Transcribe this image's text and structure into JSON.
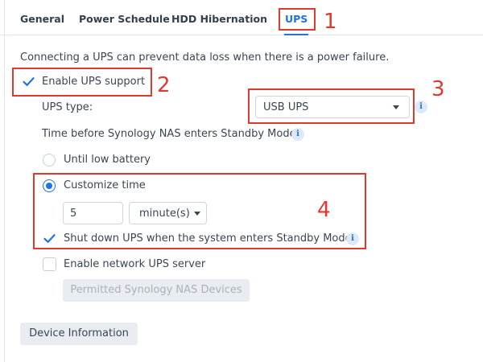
{
  "tabs": [
    {
      "label": "General",
      "active": false
    },
    {
      "label": "Power Schedule",
      "active": false
    },
    {
      "label": "HDD Hibernation",
      "active": false
    },
    {
      "label": "UPS",
      "active": true
    }
  ],
  "description": "Connecting a UPS can prevent data loss when there is a power failure.",
  "enable_ups": {
    "label": "Enable UPS support",
    "checked": true
  },
  "ups_type": {
    "label": "UPS type:",
    "value": "USB UPS",
    "info_icon": "i"
  },
  "standby": {
    "label": "Time before Synology NAS enters Standby Mode",
    "info_icon": "i"
  },
  "until_low_battery": {
    "label": "Until low battery",
    "checked": false
  },
  "customize_time": {
    "label": "Customize time",
    "checked": true
  },
  "time_value": "5",
  "time_unit": "minute(s)",
  "shutdown_ups": {
    "label": "Shut down UPS when the system enters Standby Mode",
    "checked": true,
    "info_icon": "i"
  },
  "network_ups": {
    "label": "Enable network UPS server",
    "checked": false
  },
  "permitted_devices_button": "Permitted Synology NAS Devices",
  "device_info_button": "Device Information",
  "annotations": [
    "1",
    "2",
    "3",
    "4"
  ],
  "colors": {
    "accent": "#1f74e2",
    "annotation": "#e03a2f"
  }
}
